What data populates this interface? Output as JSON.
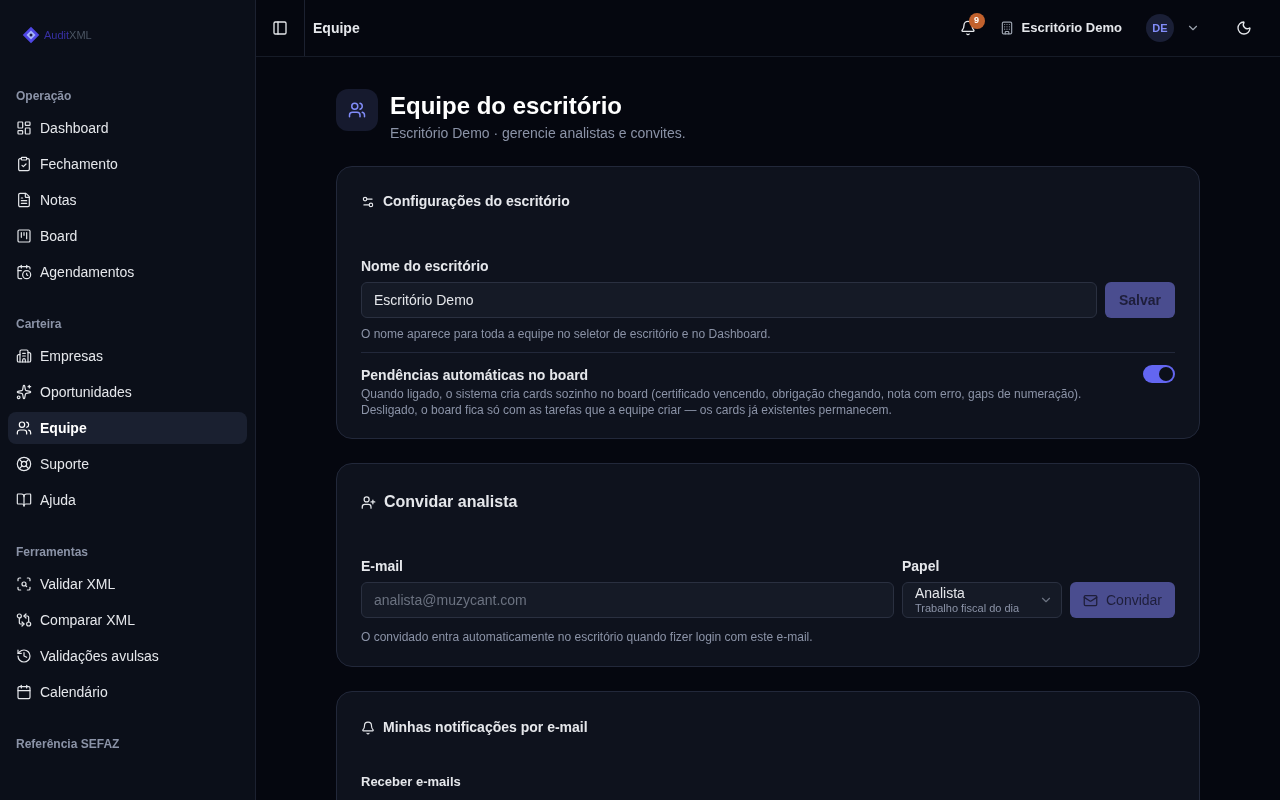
{
  "logo": {
    "brand": "Audit",
    "suffix": "XML"
  },
  "sidebar": {
    "sections": [
      {
        "title": "Operação",
        "items": [
          {
            "label": "Dashboard",
            "selected": false
          },
          {
            "label": "Fechamento",
            "selected": false
          },
          {
            "label": "Notas",
            "selected": false
          },
          {
            "label": "Board",
            "selected": false
          },
          {
            "label": "Agendamentos",
            "selected": false
          }
        ]
      },
      {
        "title": "Carteira",
        "items": [
          {
            "label": "Empresas",
            "selected": false
          },
          {
            "label": "Oportunidades",
            "selected": false
          },
          {
            "label": "Equipe",
            "selected": true
          },
          {
            "label": "Suporte",
            "selected": false
          },
          {
            "label": "Ajuda",
            "selected": false
          }
        ]
      },
      {
        "title": "Ferramentas",
        "items": [
          {
            "label": "Validar XML",
            "selected": false
          },
          {
            "label": "Comparar XML",
            "selected": false
          },
          {
            "label": "Validações avulsas",
            "selected": false
          },
          {
            "label": "Calendário",
            "selected": false
          }
        ]
      },
      {
        "title": "Referência SEFAZ"
      }
    ]
  },
  "header": {
    "title": "Equipe",
    "notifications": "9",
    "office": "Escritório Demo",
    "avatar": "DE"
  },
  "page": {
    "title": "Equipe do escritório",
    "subtitle": "Escritório Demo · gerencie analistas e convites."
  },
  "settings": {
    "title": "Configurações do escritório",
    "name_label": "Nome do escritório",
    "name_value": "Escritório Demo",
    "save": "Salvar",
    "name_hint": "O nome aparece para toda a equipe no seletor de escritório e no Dashboard.",
    "auto_label": "Pendências automáticas no board",
    "auto_desc": [
      "Quando ligado, o sistema cria cards sozinho no board (certificado vencendo, obrigação chegando, nota com erro, gaps de numeração).",
      "Desligado, o board fica só com as tarefas que a equipe criar — os cards já existentes permanecem."
    ],
    "auto_on": true
  },
  "invite": {
    "title": "Convidar analista",
    "email_label": "E-mail",
    "email_placeholder": "analista@muzycant.com",
    "role_label": "Papel",
    "role_value": "Analista",
    "role_desc": "Trabalho fiscal do dia",
    "button": "Convidar",
    "hint": "O convidado entra automaticamente no escritório quando fizer login com este e-mail."
  },
  "notifications": {
    "title": "Minhas notificações por e-mail",
    "field_label": "Receber e-mails"
  }
}
